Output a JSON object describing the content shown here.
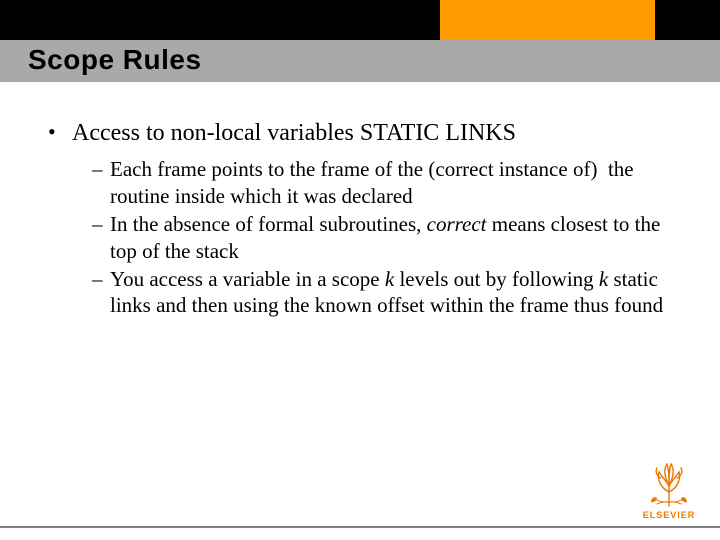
{
  "title": "Scope Rules",
  "main_bullet": "Access to non-local variables STATIC LINKS",
  "sub_bullets": {
    "b1a": "Each frame points to the frame of the (correct instance of)  the routine inside which it was declared",
    "b2a": "In the absence of formal subroutines, ",
    "b2_italic": "correct",
    "b2b": " means closest to the top of the stack",
    "b3a": "You access a variable in a scope ",
    "b3_k1": "k",
    "b3b": " levels out by following ",
    "b3_k2": "k",
    "b3c": " static links and then using the known offset within the frame thus found"
  },
  "logo_label": "ELSEVIER"
}
